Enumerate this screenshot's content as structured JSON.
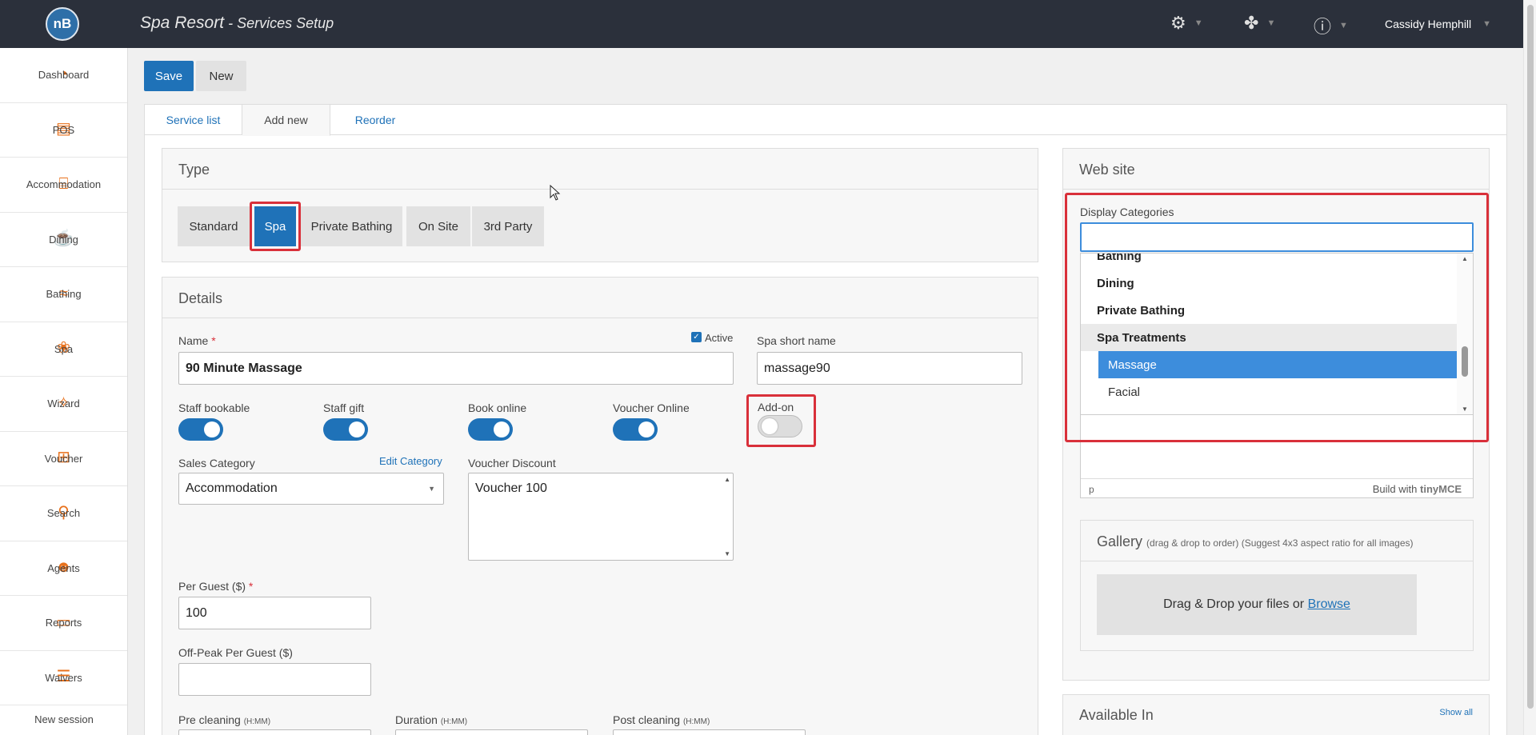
{
  "header": {
    "logo_text": "nB",
    "title_main": "Spa Resort",
    "title_sep": " - ",
    "title_sub": "Services Setup",
    "user_name": "Cassidy Hemphill"
  },
  "sidebar": {
    "items": [
      {
        "label": "Dashboard",
        "icon": "dashboard-icon"
      },
      {
        "label": "POS",
        "icon": "cash-register-icon"
      },
      {
        "label": "Accommodation",
        "icon": "bed-icon"
      },
      {
        "label": "Dining",
        "icon": "dining-icon"
      },
      {
        "label": "Bathing",
        "icon": "waves-icon"
      },
      {
        "label": "Spa",
        "icon": "lotus-icon"
      },
      {
        "label": "Wizard",
        "icon": "magic-wand-icon"
      },
      {
        "label": "Voucher",
        "icon": "gift-icon"
      },
      {
        "label": "Search",
        "icon": "search-icon"
      },
      {
        "label": "Agents",
        "icon": "agents-icon"
      },
      {
        "label": "Reports",
        "icon": "document-icon"
      },
      {
        "label": "Waivers",
        "icon": "checklist-icon"
      }
    ],
    "new_session": "New session"
  },
  "toolbar": {
    "save": "Save",
    "new": "New"
  },
  "tabs": [
    "Service list",
    "Add new",
    "Reorder"
  ],
  "type_panel": {
    "title": "Type",
    "options": [
      "Standard",
      "Spa",
      "Private Bathing",
      "On Site",
      "3rd Party"
    ],
    "selected": "Spa"
  },
  "details": {
    "title": "Details",
    "name_label": "Name",
    "required_mark": "*",
    "name_value": "90 Minute Massage",
    "active_label": "Active",
    "active_checked": true,
    "short_name_label": "Spa short name",
    "short_name_value": "massage90",
    "toggles": [
      {
        "label": "Staff bookable",
        "on": true
      },
      {
        "label": "Staff gift",
        "on": true
      },
      {
        "label": "Book online",
        "on": true
      },
      {
        "label": "Voucher Online",
        "on": true
      },
      {
        "label": "Add-on",
        "on": false
      }
    ],
    "sales_category_label": "Sales Category",
    "edit_category": "Edit Category",
    "sales_category_value": "Accommodation",
    "voucher_discount_label": "Voucher Discount",
    "voucher_discount_value": "Voucher 100",
    "per_guest_label": "Per Guest ($)",
    "per_guest_value": "100",
    "offpeak_label": "Off-Peak Per Guest ($)",
    "offpeak_value": "",
    "pre_cleaning_label": "Pre cleaning",
    "duration_label": "Duration",
    "post_cleaning_label": "Post cleaning",
    "time_hint": "(H:MM)"
  },
  "website": {
    "title": "Web site",
    "display_categories_label": "Display Categories",
    "search_value": "",
    "list": [
      {
        "text": "Bathing",
        "kind": "group"
      },
      {
        "text": "Dining",
        "kind": "group"
      },
      {
        "text": "Private Bathing",
        "kind": "group"
      },
      {
        "text": "Spa Treatments",
        "kind": "group"
      },
      {
        "text": "Massage",
        "kind": "option"
      },
      {
        "text": "Facial",
        "kind": "option"
      }
    ],
    "selected_option": "Massage",
    "editor_status": "p",
    "editor_credit": "Build with",
    "editor_brand": "tinyMCE"
  },
  "gallery": {
    "title": "Gallery",
    "hint": "(drag & drop to order) (Suggest 4x3 aspect ratio for all images)",
    "drop_text": "Drag & Drop your files or",
    "browse": "Browse"
  },
  "available_in": {
    "title": "Available In",
    "show_all": "Show all"
  }
}
